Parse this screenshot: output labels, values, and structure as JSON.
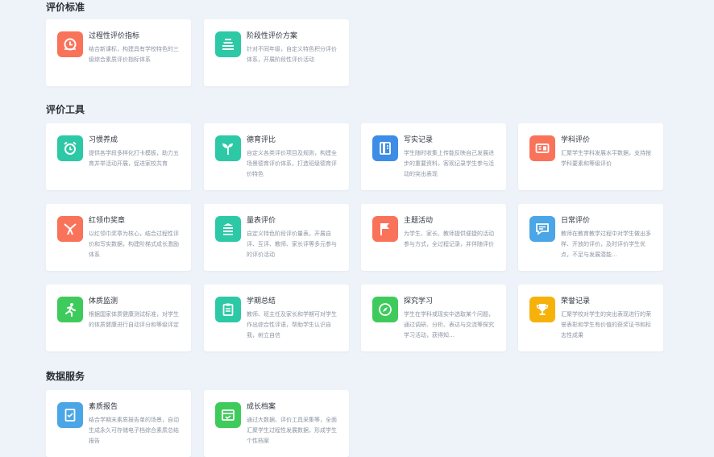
{
  "sections": [
    {
      "title": "评价标准"
    },
    {
      "title": "评价工具"
    },
    {
      "title": "数据服务"
    }
  ],
  "colors": {
    "orange": "#f9735b",
    "teal": "#2dc9a6",
    "blue": "#3d8ce6",
    "green": "#3fcb5c",
    "yellow": "#f6b20a",
    "skyblue": "#4aa6e6"
  },
  "cards": [
    {
      "title": "过程性评价指标",
      "desc": "结合新课标，构建具有学校特色的三级综合素质评价指标体系",
      "icon": "clock-arrow-icon",
      "color": "#f9735b"
    },
    {
      "title": "阶段性评价方案",
      "desc": "针对不同年级，自定义特色积分评价体系，开展阶段性评价活动",
      "icon": "layers-icon",
      "color": "#2dc9a6"
    },
    {
      "title": "习惯养成",
      "desc": "提供各学段多样化打卡模板，助力五育并举活动开展，促进家校共育",
      "icon": "alarm-clock-icon",
      "color": "#2dc9a6"
    },
    {
      "title": "德育评比",
      "desc": "自定义各类评价项目及规则，构建全场景德育评价体系，打造班级德育评价特色",
      "icon": "sprout-icon",
      "color": "#2dc9a6"
    },
    {
      "title": "写实记录",
      "desc": "学生随时收集上传能反映自己发展进步的重要资料，客观记录学生参与活动的突出表现",
      "icon": "notebook-icon",
      "color": "#3d8ce6"
    },
    {
      "title": "学科评价",
      "desc": "汇聚学生学科发展水平数据，支持按学科要素和等级评价",
      "icon": "subject-card-icon",
      "color": "#f9735b"
    },
    {
      "title": "红领巾奖章",
      "desc": "以红领巾奖章为核心，结合过程性评价和写实数据，构建阶梯式成长激励体系",
      "icon": "scarf-icon",
      "color": "#f9735b"
    },
    {
      "title": "量表评价",
      "desc": "自定义特色阶段评价量表，开展自评、互评、教师、家长评等多元参与的评价活动",
      "icon": "stack-icon",
      "color": "#2dc9a6"
    },
    {
      "title": "主题活动",
      "desc": "为学生、家长、教师提供便捷的活动参与方式，全过程记录，并伴随评价",
      "icon": "flag-icon",
      "color": "#f9735b"
    },
    {
      "title": "日常评价",
      "desc": "教师在教育教学过程中对学生做出多样、开放的评价，及时评价学生优点，不足与发展潜能…",
      "icon": "chat-icon",
      "color": "#4aa6e6"
    },
    {
      "title": "体质监测",
      "desc": "根据国家体质健康测试标准，对学生的体质健康进行自动评分和等级评定",
      "icon": "runner-icon",
      "color": "#3fcb5c"
    },
    {
      "title": "学期总结",
      "desc": "教师、班主任及家长和学期可对学生作出综合性评语，帮助学生认识自我，树立自信",
      "icon": "clipboard-icon",
      "color": "#2dc9a6"
    },
    {
      "title": "探究学习",
      "desc": "学生在学科或现实中选取某个问题，通过调研、分析、表达与交流等探究学习活动，获得知…",
      "icon": "compass-icon",
      "color": "#3fcb5c"
    },
    {
      "title": "荣誉记录",
      "desc": "汇聚学校对学生的突出表现进行的荣誉表彰和学生有价值的获奖证书和标志性成果",
      "icon": "trophy-icon",
      "color": "#f6b20a"
    },
    {
      "title": "素质报告",
      "desc": "结合学期末素质报告单的场景，自动生成永久可存储电子档综合素质总结报告",
      "icon": "report-icon",
      "color": "#4aa6e6"
    },
    {
      "title": "成长档案",
      "desc": "通过大数据、评价工具采集等，全面汇聚学生过程性发展数据，形成学生个性档案",
      "icon": "archive-icon",
      "color": "#3fcb5c"
    }
  ]
}
